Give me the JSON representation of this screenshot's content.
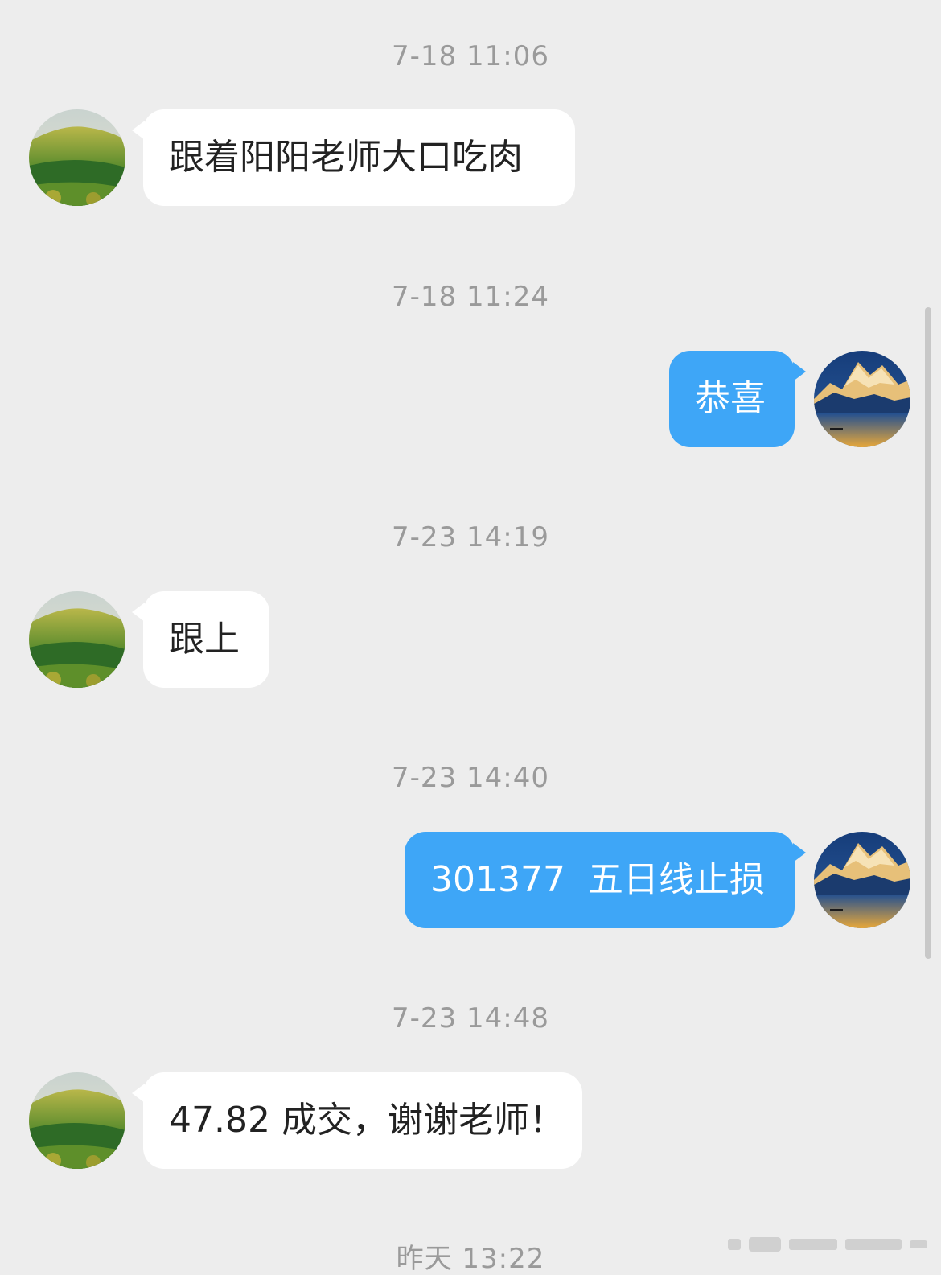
{
  "messages": [
    {
      "time": "7-18 11:06",
      "sender": "other",
      "text": "跟着阳阳老师大口吃肉"
    },
    {
      "time": "7-18 11:24",
      "sender": "self",
      "text": "恭喜"
    },
    {
      "time": "7-23 14:19",
      "sender": "other",
      "text": "跟上"
    },
    {
      "time": "7-23 14:40",
      "sender": "self",
      "text": "301377  五日线止损"
    },
    {
      "time": "7-23 14:48",
      "sender": "other",
      "text": "47.82 成交，谢谢老师！"
    },
    {
      "time": "昨天 13:22"
    }
  ],
  "avatars": {
    "other": "forest-hill-avatar",
    "self": "snow-mountain-lake-avatar"
  },
  "colors": {
    "background": "#ededed",
    "incoming_bubble": "#ffffff",
    "outgoing_bubble": "#3ea6f7",
    "timestamp": "#9a9a9a"
  }
}
